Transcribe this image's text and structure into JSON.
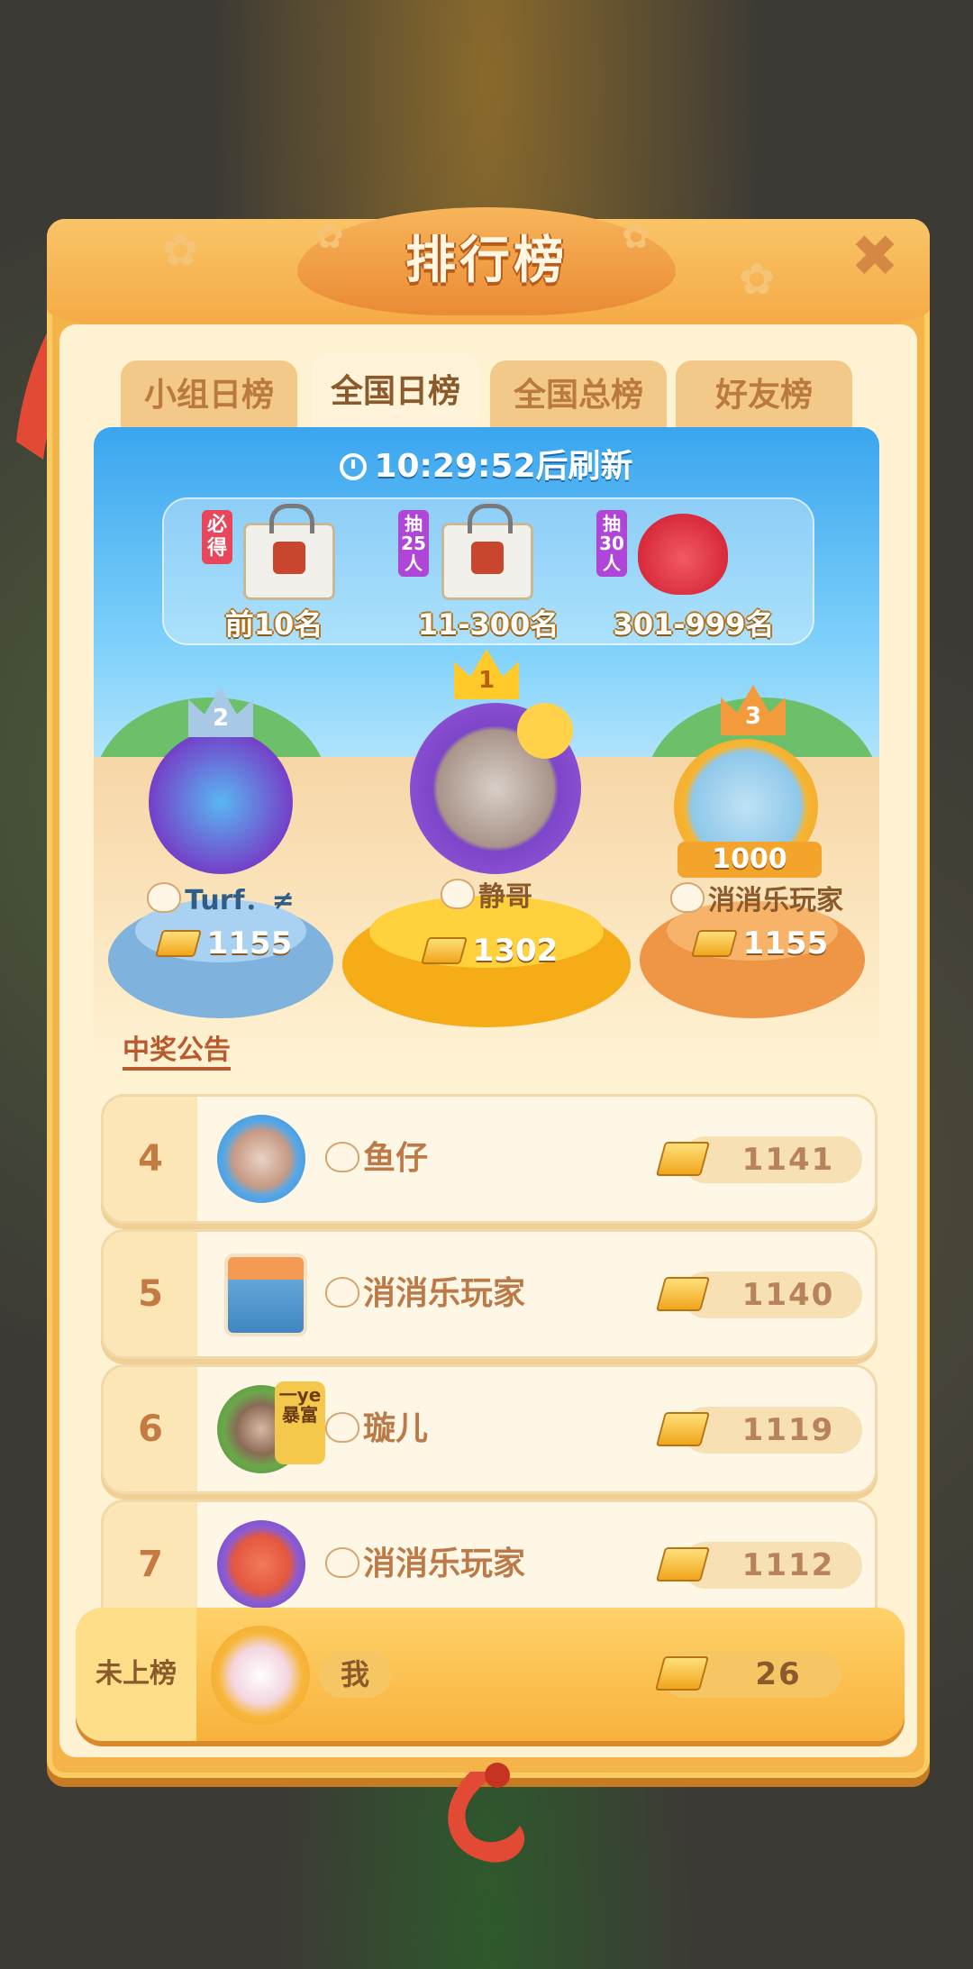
{
  "header": {
    "title": "排行榜",
    "close_icon": "close-icon"
  },
  "tabs": [
    {
      "label": "小组日榜",
      "active": false
    },
    {
      "label": "全国日榜",
      "active": true
    },
    {
      "label": "全国总榜",
      "active": false
    },
    {
      "label": "好友榜",
      "active": false
    }
  ],
  "refresh": {
    "time": "10:29:52",
    "suffix": "后刷新"
  },
  "prizes": [
    {
      "tag": "必得",
      "tag_color": "#e8465a",
      "label": "前10名",
      "icon": "gift-bag-icon"
    },
    {
      "tag": "抽25人",
      "tag_color": "#b046d8",
      "label": "11-300名",
      "icon": "gift-bag-icon"
    },
    {
      "tag": "抽30人",
      "tag_color": "#b046d8",
      "label": "301-999名",
      "icon": "red-fox-plush-icon"
    }
  ],
  "podium": {
    "first": {
      "rank": "1",
      "name": "静哥",
      "score": "1302"
    },
    "second": {
      "rank": "2",
      "name": "Turf．≠",
      "score": "1155"
    },
    "third": {
      "rank": "3",
      "name": "消消乐玩家",
      "score": "1155",
      "badge": "1000"
    }
  },
  "announcement": "中奖公告",
  "list": [
    {
      "rank": "4",
      "name": "鱼仔",
      "score": "1141"
    },
    {
      "rank": "5",
      "name": "消消乐玩家",
      "score": "1140"
    },
    {
      "rank": "6",
      "name": "璇儿",
      "score": "1119",
      "avatar_text": "一ye暴富"
    },
    {
      "rank": "7",
      "name": "消消乐玩家",
      "score": "1112"
    }
  ],
  "me": {
    "rank_label": "未上榜",
    "name": "我",
    "score": "26"
  },
  "colors": {
    "panel": "#f5b449",
    "inner": "#fff2d3",
    "gold": "#f0a51c",
    "sky": "#3aa5ee"
  }
}
